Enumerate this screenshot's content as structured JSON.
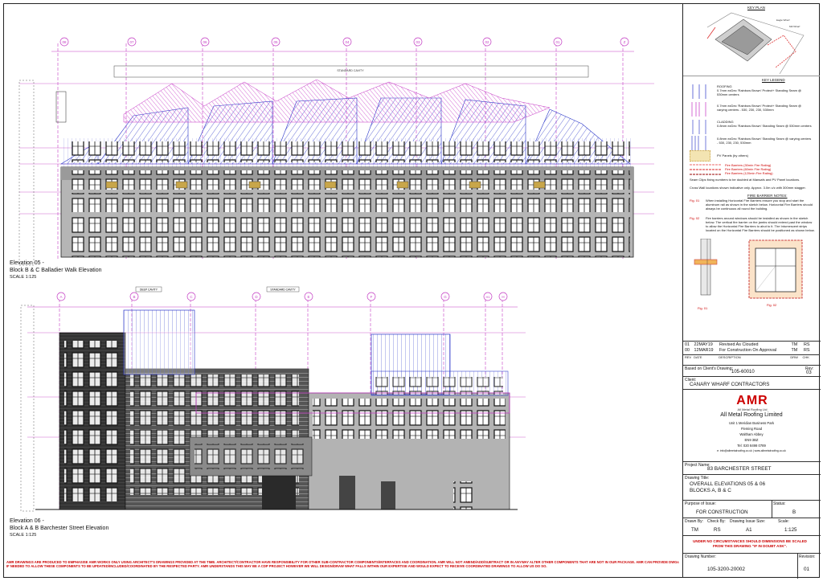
{
  "elevation05": {
    "title_line1": "Elevation 05 -",
    "title_line2": "Block B & C Balladier Walk Elevation",
    "scale": "SCALE 1:125",
    "grid": [
      "08",
      "07",
      "06",
      "05",
      "04",
      "03",
      "02",
      "01",
      "Z"
    ]
  },
  "elevation06": {
    "title_line1": "Elevation 06 -",
    "title_line2": "Block A & B Barchester Street Elevation",
    "scale": "SCALE 1:125",
    "grid": [
      "A",
      "B",
      "C",
      "D",
      "E",
      "F",
      "G",
      "H1",
      "H"
    ],
    "tag_deep": "DEEP CAVITY",
    "tag_standard": "STANDARD CAVITY"
  },
  "standard_cavity_label": "STANDARD CAVITY",
  "key_plan": {
    "title": "KEY PLAN"
  },
  "key_legend": {
    "title": "KEY LEGEND",
    "roofing_heading": "ROOFING",
    "items": [
      "0.7mm ezDec 'Rainbow Brown' Protect+ Standing Seam @ 530mm centers",
      "0.7mm ezDec 'Rainbow Brown' Protect+ Standing Seam @ varying centers - 530, 230, 230, 530mm",
      "0.8mm ezDec 'Rainbow Brown' Standing Seam @ 530mm centers",
      "0.8mm ezDec 'Rainbow Brown' Standing Seam @ varying centers - 530, 230, 230, 530mm",
      "PV Panels (by others)"
    ],
    "cladding_heading": "CLADDING",
    "fire_barriers": [
      "Fire Barriers (30min Fire Rating)",
      "Fire Barriers (60min Fire Rating)",
      "Fire Barriers (120min Fire Rating)"
    ],
    "fire_colors": {
      "c30": "#e66",
      "c60": "#d22",
      "c120": "#900"
    },
    "notes": [
      "Seam Clips fixing numbers to be doubled at Mansafs and PV Panel locations.",
      "Cross Wall locations shown indicative only. Approx. 3.0m c/c with 300mm stagger."
    ]
  },
  "fire_notes": {
    "title": "FIRE BARRIER NOTES:",
    "fig01_label": "Fig. 01",
    "fig01_text": "When installing Horizontal Fire Barriers ensure you stop and start the aluminum rail as shown in the sketch below. Horizontal Fire Barriers should always be continuous all round the building.",
    "fig02_label": "Fig. 02",
    "fig02_text": "Fire barriers around windows should be installed as shown in the sketch below. The vertical fire barrier on the jambs should extend past the window to allow the Horizontal Fire Barriers to abut to it. The Intumescent strips located on the Horizontal Fire Barriers should be positioned as shown below.",
    "fig_caption_1": "Fig. 01",
    "fig_caption_2": "Fig. 02"
  },
  "revisions": [
    {
      "rev": "01",
      "date": "22MAY19",
      "desc": "Revised As Clouded",
      "drw": "TM",
      "chk": "RS"
    },
    {
      "rev": "00",
      "date": "12MAR19",
      "desc": "For Construction On Approval",
      "drw": "TM",
      "chk": "RS"
    }
  ],
  "rev_headers": {
    "rev": "REV",
    "date": "DATE",
    "desc": "DESCRIPTION",
    "drw": "DRW",
    "chk": "CHK"
  },
  "based_on": {
    "label": "Based on Client's Drawing:",
    "value": "105-60010",
    "rev_label": "Rev:",
    "rev_value": "03"
  },
  "client": {
    "label": "Client:",
    "value": "CANARY WHARF CONTRACTORS"
  },
  "company": {
    "logo_text": "AMR",
    "logo_sub": "All Metal Roofing Ltd",
    "name": "All Metal Roofing Limited",
    "address": [
      "Unit 1 Meridian Business Park",
      "Fleming Road",
      "Waltham Abbey",
      "EN9 3BZ",
      "Tel: 020 8498 0789"
    ],
    "contact": "e: info@allmetalroofing.co.uk | www.allmetalroofing.co.uk"
  },
  "project": {
    "label": "Project Name:",
    "value": "83 BARCHESTER STREET"
  },
  "drawing_title": {
    "label": "Drawing Title:",
    "line1": "OVERALL ELEVATIONS 05 & 06",
    "line2": "BLOCKS A, B & C"
  },
  "purpose": {
    "label": "Purpose of Issue:",
    "value": "FOR CONSTRUCTION",
    "status_label": "Status:",
    "status_value": "B"
  },
  "drawn": {
    "drawn_label": "Drawn By:",
    "check_label": "Check By:",
    "size_label": "Drawing Issue Size:",
    "scale_label": "Scale:",
    "drawn": "TM",
    "check": "RS",
    "size": "A1",
    "scale": "1:125"
  },
  "warning": "UNDER NO CIRCUMSTANCES SHOULD DIMENSIONS BE SCALED FROM THIS DRAWING \"IF IN DOUBT ASK\".",
  "drawing_number": {
    "label": "Drawing Number:",
    "value": "105-3200-20002",
    "rev_label": "Revision:",
    "rev_value": "01"
  },
  "bottom_note": "AMR DRAWINGS ARE PRODUCED TO EMPHASISE AMR WORKS ONLY USING ARCHITECT'S DRAWINGS PROVIDED AT THE TIME. ARCHITECT/CONTRACTOR HAVE RESPONSIBILITY FOR OTHER SUB-CONTRACTOR COMPONENTS/INTERFACES AND COORDINATION. AMR WILL NOT AMEND/ADD/SUBTRACT OR IN ANYWAY ALTER OTHER COMPONENTS THAT ARE NOT IN OUR PACKAGE. AMR CAN PROVIDE DWGs IF NEEDED TO ALLOW THESE COMPONENTS TO BE UPDATED/INCLUDED/COORDINATED BY THE RESPECTED PARTY. AMR UNDERSTANDS THIS MAY BE A CDP PROJECT HOWEVER WE WILL DESIGN/DRAW WHAT FALLS WITHIN OUR EXPERTISE AND WOULD EXPECT TO RECEIVE COORDINATED DRAWINGS TO ALLOW US DO SO."
}
